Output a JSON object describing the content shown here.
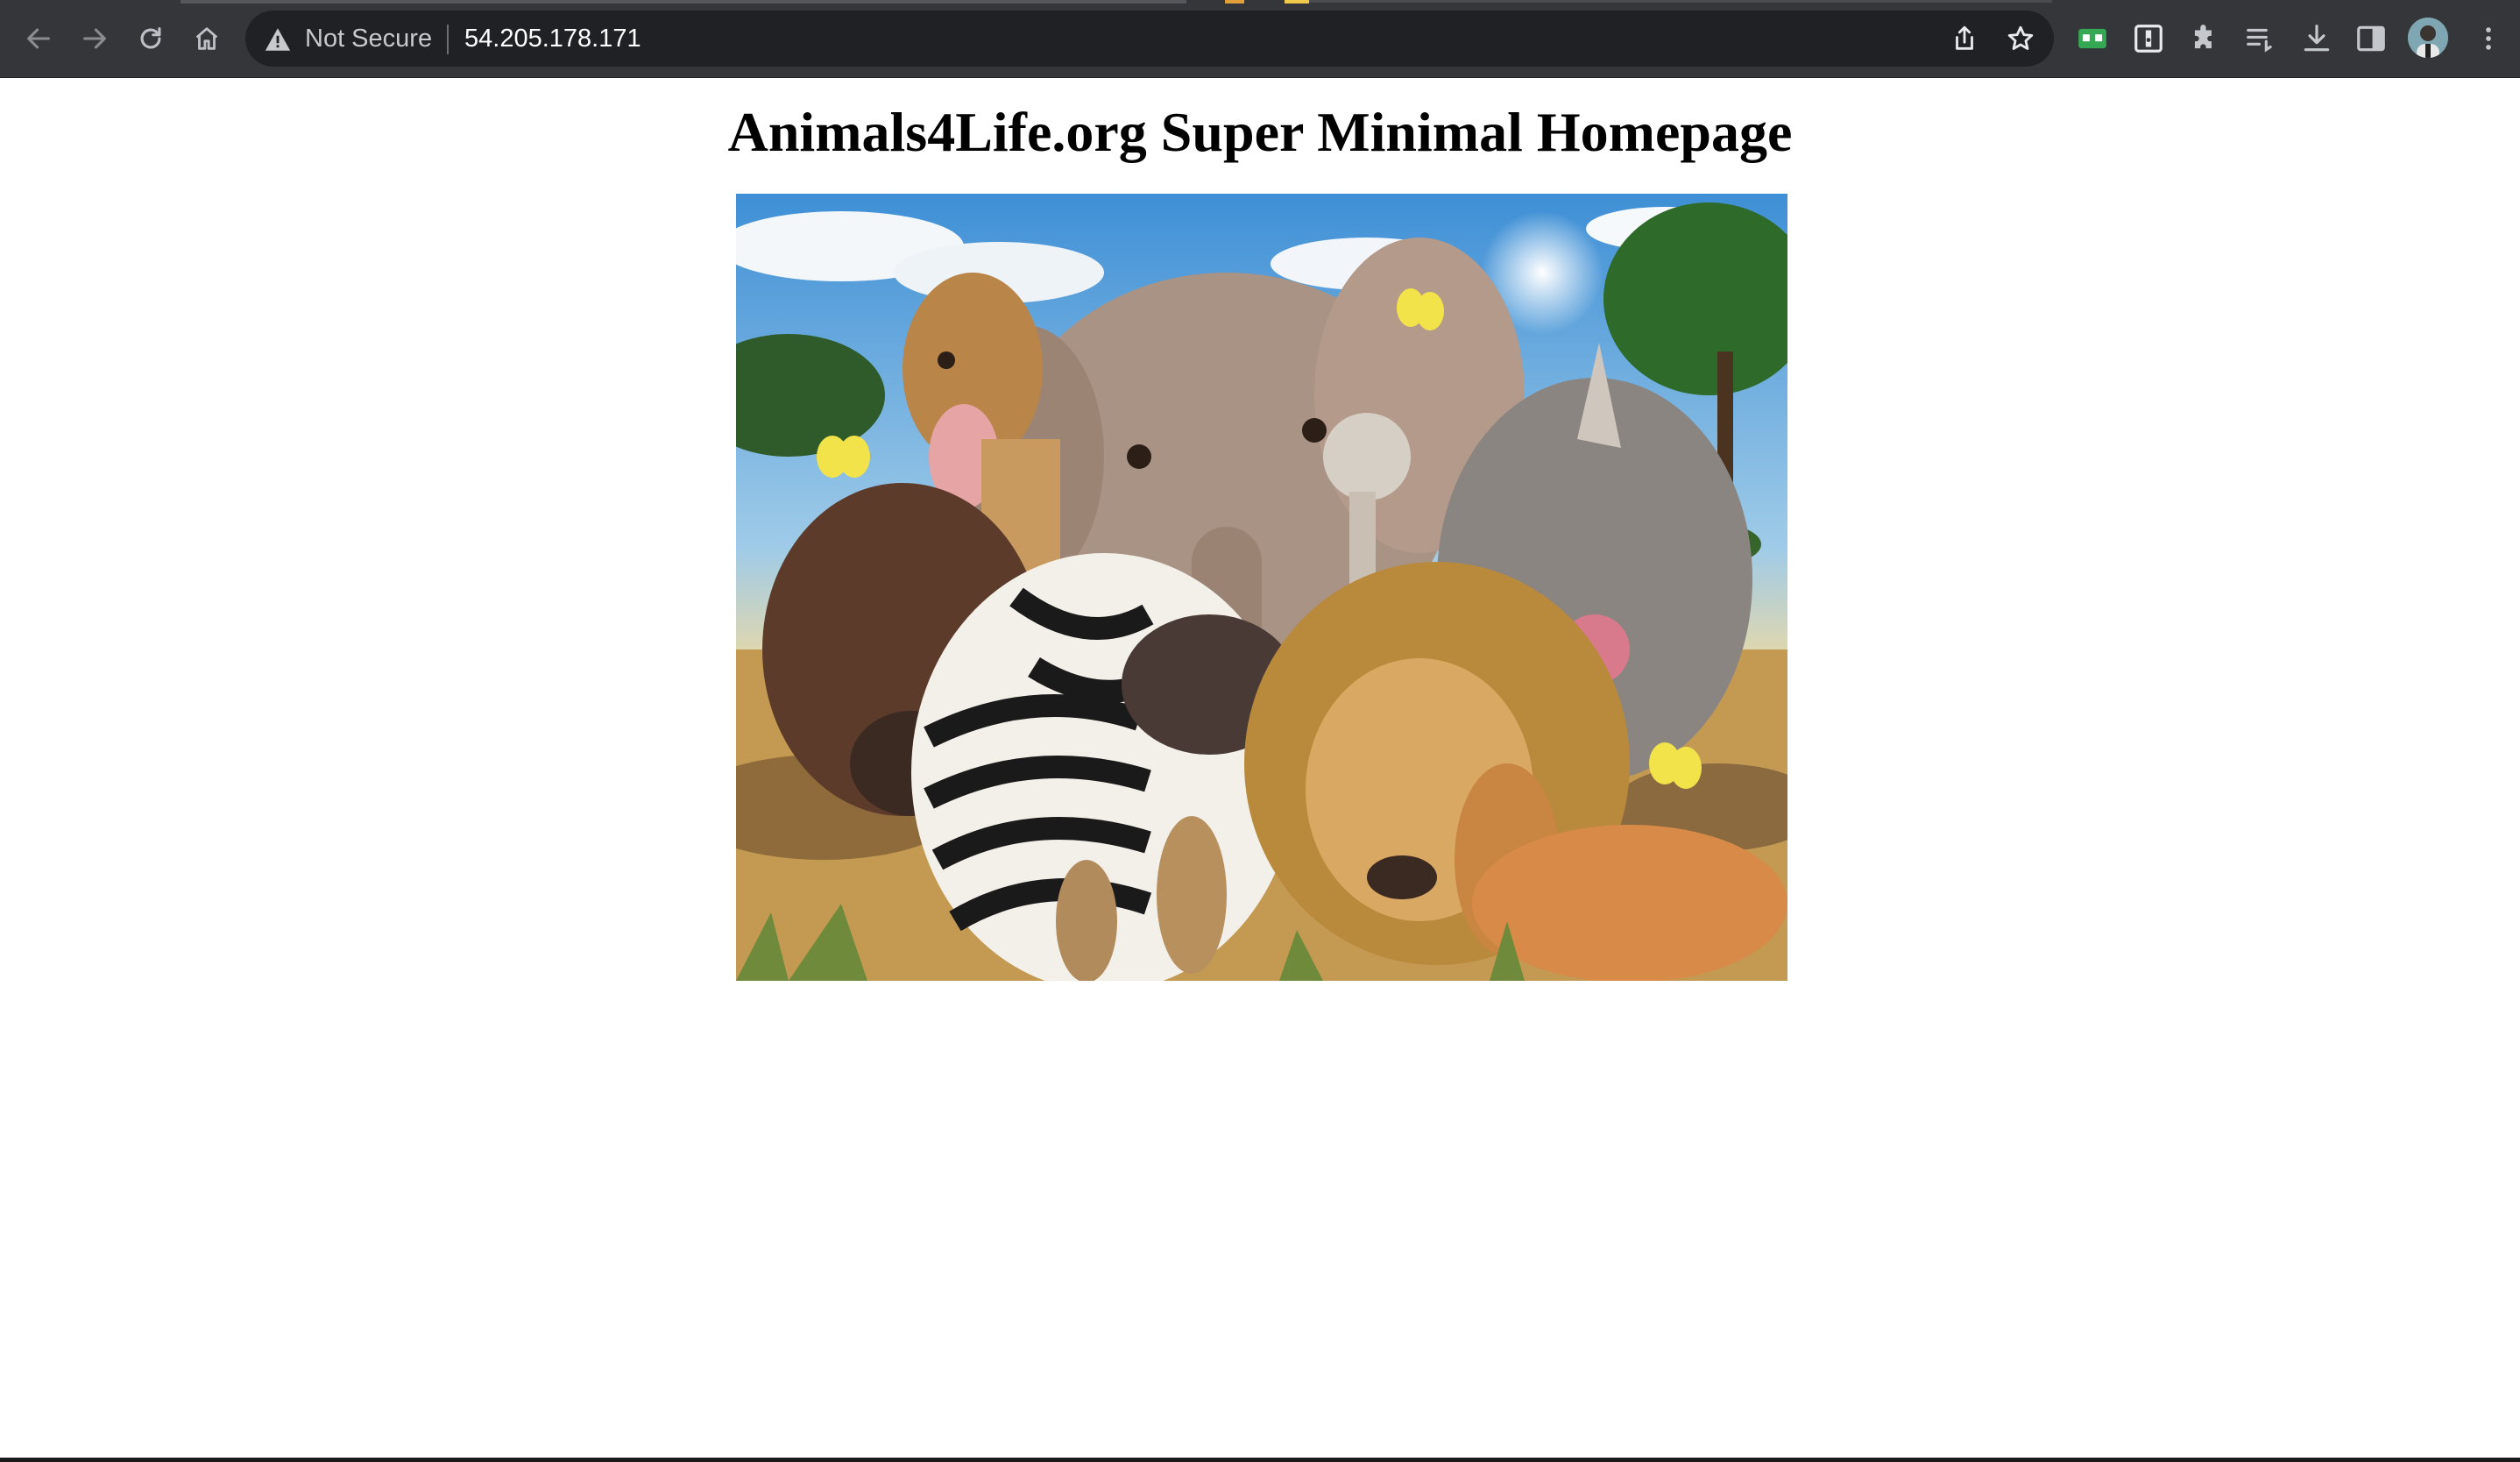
{
  "browser": {
    "security_label": "Not Secure",
    "url": "54.205.178.171",
    "icons": {
      "back": "back-arrow-icon",
      "forward": "forward-arrow-icon",
      "reload": "reload-icon",
      "home": "home-icon",
      "warning": "warning-triangle-icon",
      "share": "share-icon",
      "bookmark": "star-icon",
      "extensions": [
        "ext-green-icon",
        "ext-box-icon",
        "puzzle-icon",
        "reading-list-icon",
        "download-icon",
        "side-panel-icon"
      ],
      "profile": "avatar",
      "menu": "kebab-menu-icon"
    },
    "colors": {
      "toolbar": "#35363a",
      "omnibox": "#202124",
      "text": "#ffffff",
      "muted": "#c7c9cc"
    }
  },
  "page": {
    "heading": "Animals4Life.org Super Minimal Homepage",
    "image_alt_subject": "safari animals selfie illustration"
  }
}
